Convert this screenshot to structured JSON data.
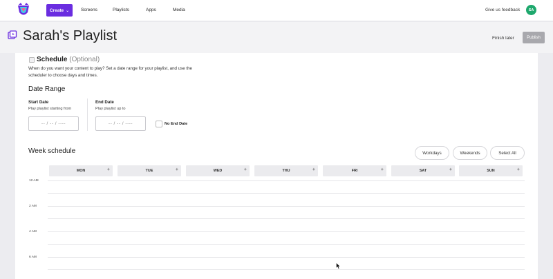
{
  "nav": {
    "create_label": "Create",
    "links": [
      "Screens",
      "Playlists",
      "Apps",
      "Media"
    ],
    "feedback": "Give us feedback",
    "avatar_initials": "SA"
  },
  "header": {
    "title": "Sarah's Playlist",
    "finish_later": "Finish later",
    "publish": "Publish"
  },
  "schedule": {
    "title": "Schedule",
    "optional": "(Optional)",
    "description": "When do you want your content to play? Set a date range for your playlist, and use the scheduler to choose days and times."
  },
  "date_range": {
    "title": "Date Range",
    "start_label": "Start Date",
    "start_sub": "Play playlist starting from",
    "end_label": "End Date",
    "end_sub": "Play playlist up to",
    "placeholder": "-- / -- / ----",
    "no_end_date": "No End Date"
  },
  "week": {
    "title": "Week schedule",
    "buttons": [
      "Workdays",
      "Weekends",
      "Select All"
    ],
    "days": [
      "MON",
      "TUE",
      "WED",
      "THU",
      "FRI",
      "SAT",
      "SUN"
    ],
    "add_symbol": "+",
    "hours": [
      "12 AM",
      "2 AM",
      "4 AM",
      "6 AM"
    ]
  },
  "colors": {
    "brand": "#6a2de0",
    "avatar": "#1ea86d",
    "publish_disabled": "#a8a8ad"
  }
}
